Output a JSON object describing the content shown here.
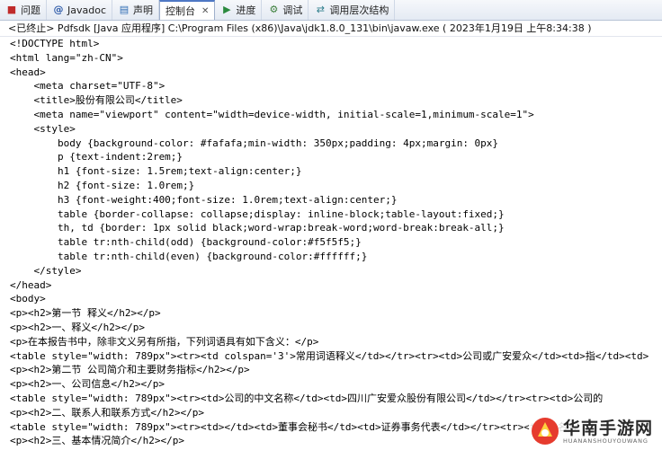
{
  "tabs": [
    {
      "label": "问题",
      "icon": "problems-icon",
      "active": false
    },
    {
      "label": "Javadoc",
      "icon": "javadoc-icon",
      "active": false
    },
    {
      "label": "声明",
      "icon": "declaration-icon",
      "active": false
    },
    {
      "label": "控制台",
      "icon": "console-icon",
      "active": true
    },
    {
      "label": "进度",
      "icon": "progress-icon",
      "active": false
    },
    {
      "label": "调试",
      "icon": "debug-icon",
      "active": false
    },
    {
      "label": "调用层次结构",
      "icon": "call-hierarchy-icon",
      "active": false
    }
  ],
  "status_line": "<已终止> Pdfsdk [Java 应用程序] C:\\Program Files (x86)\\Java\\jdk1.8.0_131\\bin\\javaw.exe ( 2023年1月19日 上午8:34:38 )",
  "console_lines": [
    "<!DOCTYPE html>",
    "<html lang=\"zh-CN\">",
    "<head>",
    "    <meta charset=\"UTF-8\">",
    "    <title>股份有限公司</title>",
    "    <meta name=\"viewport\" content=\"width=device-width, initial-scale=1,minimum-scale=1\">",
    "    <style>",
    "        body {background-color: #fafafa;min-width: 350px;padding: 4px;margin: 0px}",
    "        p {text-indent:2rem;}",
    "        h1 {font-size: 1.5rem;text-align:center;}",
    "        h2 {font-size: 1.0rem;}",
    "        h3 {font-weight:400;font-size: 1.0rem;text-align:center;}",
    "        table {border-collapse: collapse;display: inline-block;table-layout:fixed;}",
    "        th, td {border: 1px solid black;word-wrap:break-word;word-break:break-all;}",
    "        table tr:nth-child(odd) {background-color:#f5f5f5;}",
    "        table tr:nth-child(even) {background-color:#ffffff;}",
    "    </style>",
    "</head>",
    "<body>",
    "<p><h2>第一节 释义</h2></p>",
    "<p><h2>一、释义</h2></p>",
    "<p>在本报告书中，除非文义另有所指，下列词语具有如下含义：</p>",
    "<table style=\"width: 789px\"><tr><td colspan='3'>常用词语释义</td></tr><tr><td>公司或广安爱众</td><td>指</td><td>",
    "<p><h2>第二节 公司简介和主要财务指标</h2></p>",
    "<p><h2>一、公司信息</h2></p>",
    "<table style=\"width: 789px\"><tr><td>公司的中文名称</td><td>四川广安爱众股份有限公司</td></tr><tr><td>公司的",
    "<p><h2>二、联系人和联系方式</h2></p>",
    "<table style=\"width: 789px\"><tr><td></td><td>董事会秘书</td><td>证券事务代表</td></tr><tr><td>姓名</",
    "<p><h2>三、基本情况简介</h2></p>"
  ],
  "watermark": {
    "title": "华南手游网",
    "subtitle": "HUANANSHOUYOUWANG"
  }
}
